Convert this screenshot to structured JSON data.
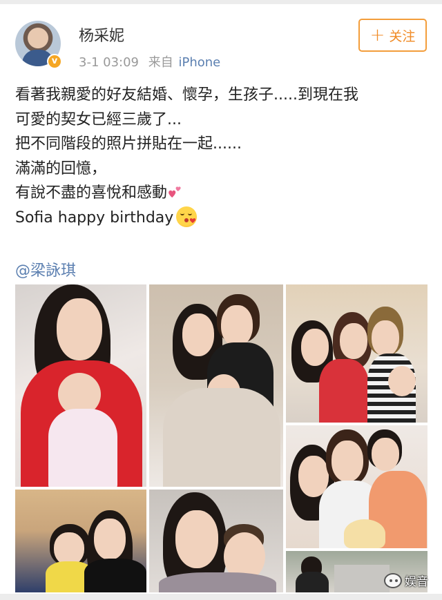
{
  "post": {
    "user": {
      "name": "杨采妮",
      "verified": true
    },
    "timestamp": "3-1 03:09",
    "source_prefix": "来自",
    "device": "iPhone",
    "follow_label": "关注",
    "text_lines": [
      "看著我親愛的好友結婚、懷孕，生孩子.....到現在我",
      "可愛的契女已經三歲了...",
      "把不同階段的照片拼貼在一起......",
      "滿滿的回憶，",
      "有說不盡的喜悅和感動",
      "Sofia happy birthday"
    ],
    "mention": "@梁詠琪",
    "photo_count": 7
  },
  "watermark": {
    "text": "娱音"
  },
  "colors": {
    "follow": "#f08a24",
    "link": "#5b7fb0",
    "verified_badge": "#f5a623",
    "meta_text": "#999999"
  },
  "icons": {
    "verified": "verified-badge-icon",
    "follow_plus": "plus-icon",
    "heart_emoji": "two-hearts-icon",
    "kiss_emoji": "face-blowing-kiss-icon",
    "watermark": "wechat-icon"
  }
}
